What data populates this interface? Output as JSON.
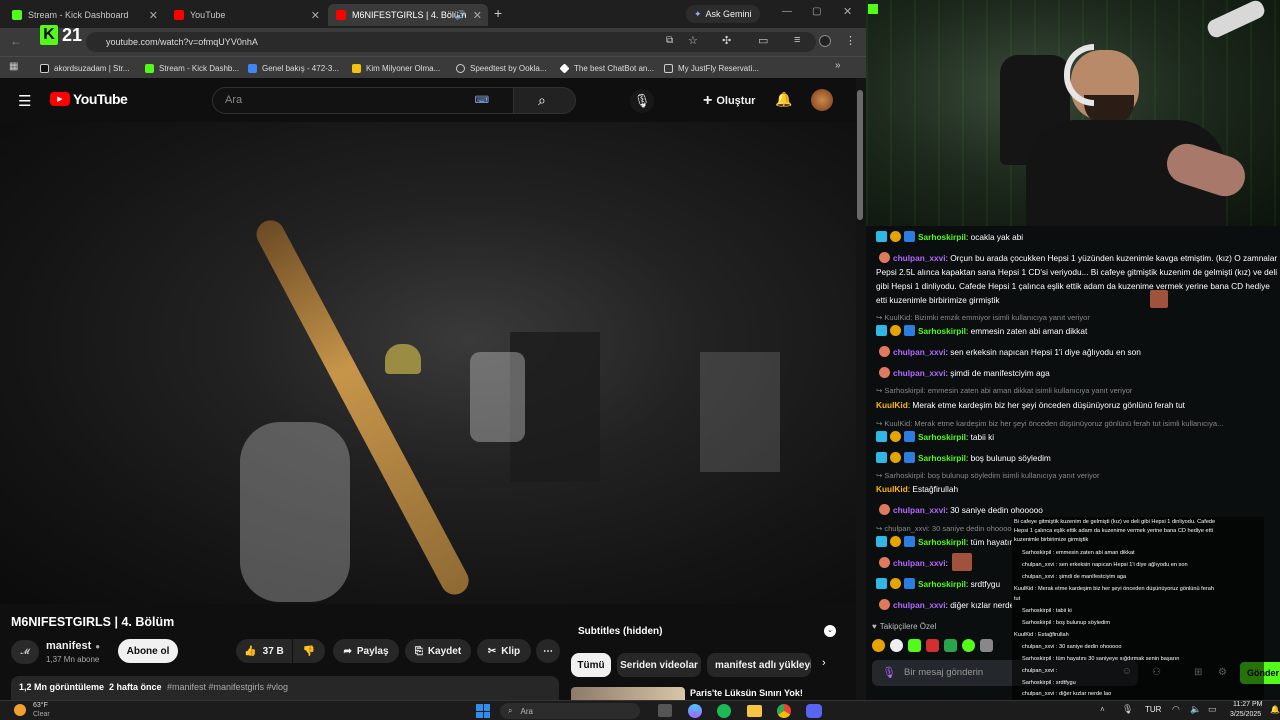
{
  "browser": {
    "tabs": [
      {
        "label": "Stream - Kick Dashboard",
        "favicon_color": "#53fc18"
      },
      {
        "label": "YouTube",
        "favicon_color": "#ff0000"
      },
      {
        "label": "M6NIFESTGIRLS | 4. Bölüm",
        "favicon_color": "#ff0000"
      }
    ],
    "new_tab": "+",
    "ask_gemini": "Ask Gemini",
    "url": "youtube.com/watch?v=ofmqUYV0nhA",
    "bookmarks": [
      "akordsuzadam | Str...",
      "Stream - Kick Dashb...",
      "Genel bakış - 472-3...",
      "Kim Milyoner Olma...",
      "Speedtest by Ookla...",
      "The best ChatBot an...",
      "My JustFly Reservati..."
    ],
    "overlay_badge": "21"
  },
  "youtube": {
    "logo": "YouTube",
    "search_placeholder": "Ara",
    "create_label": "Oluştur",
    "video_title": "M6NIFESTGIRLS | 4. Bölüm",
    "channel_name": "manifest",
    "subscribers": "1,37 Mn abone",
    "subscribe_label": "Abone ol",
    "likes": "37 B",
    "share_label": "Paylaş",
    "save_label": "Kaydet",
    "clip_label": "Klip",
    "views": "1,2 Mn görüntüleme",
    "age": "2 hafta önce",
    "tags": "#manifest #manifestgirls #vlog",
    "subtitles": "Subtitles (hidden)",
    "chips": [
      "Tümü",
      "Seriden videolar",
      "manifest adlı yükleyic"
    ],
    "next_video": "Paris'te Lüksün Sınırı Yok!"
  },
  "chat": {
    "messages": [
      {
        "user": "Sarhoskirpil",
        "text": ": ocakla yak abi",
        "color": "#53fc18"
      },
      {
        "user": "chulpan_xxvi",
        "text": ": Orçun bu arada çocukken Hepsi 1 yüzünden kuzenimle kavga etmiştim. (kız) O zamnalar Pepsi 2.5L alınca kapaktan sana Hepsi 1 CD'si veriyodu... Bi cafeye gitmiştik kuzenim de gelmişti (kız) ve deli gibi Hepsi 1 dinliyodu. Cafede Hepsi 1 çalınca eşlik ettik adam da kuzenime vermek yerine bana CD hediye etti kuzenimle birbirimize girmiştik",
        "color": "#b267ff"
      },
      {
        "reply": "KuulKid: Bizimki emzik emmiyor isimli kullanıcıya yanıt veriyor"
      },
      {
        "user": "Sarhoskirpil",
        "text": ": emmesin zaten abi aman dikkat",
        "color": "#53fc18"
      },
      {
        "user": "chulpan_xxvi",
        "text": ": sen erkeksin napıcan Hepsi 1'i diye ağlıyodu en son",
        "color": "#b267ff"
      },
      {
        "user": "chulpan_xxvi",
        "text": ": şimdi de manifestciyim aga",
        "color": "#b267ff"
      },
      {
        "reply": "Sarhoskirpil: emmesin zaten abi aman dikkat isimli kullanıcıya yanıt veriyor"
      },
      {
        "user": "KuulKid",
        "text": ": Merak etme kardeşim biz her şeyi önceden düşünüyoruz gönlünü ferah tut",
        "color": "#ffb500"
      },
      {
        "reply": "KuulKid: Merak etme kardeşim biz her şeyi önceden düşünüyoruz gönlünü ferah tut isimli kullanıcıya..."
      },
      {
        "user": "Sarhoskirpil",
        "text": ": tabii ki",
        "color": "#53fc18"
      },
      {
        "user": "Sarhoskirpil",
        "text": ": boş bulunup söyledim",
        "color": "#53fc18"
      },
      {
        "reply": "Sarhoskirpil: boş bulunup söyledim isimli kullanıcıya yanıt veriyor"
      },
      {
        "user": "KuulKid",
        "text": ": Estağfirullah",
        "color": "#ffb500"
      },
      {
        "user": "chulpan_xxvi",
        "text": ": 30 saniye dedin ohooooo",
        "color": "#b267ff"
      },
      {
        "reply": "chulpan_xxvi: 30 saniye dedin ohooooo"
      },
      {
        "user": "Sarhoskirpil",
        "text": ": tüm hayatını 30 saniyeye sığdırmak senin başarın",
        "color": "#53fc18"
      },
      {
        "user": "chulpan_xxvi",
        "text": ":",
        "color": "#b267ff"
      },
      {
        "user": "Sarhoskirpil",
        "text": ": srdtfygu",
        "color": "#53fc18"
      },
      {
        "user": "chulpan_xxvi",
        "text": ": diğer kızlar nerde lao",
        "color": "#b267ff"
      }
    ],
    "follower_label": "Takipçilere Özel",
    "input_placeholder": "Bir mesaj gönderin",
    "send_label": "Gönder"
  },
  "overlay": {
    "lines": [
      "Bi cafeye gitmiştik kuzenim de gelmişti (kız) ve deli gibi Hepsi 1 dinliyodu. Cafede",
      "Hepsi 1 çalınca eşlik ettik adam da kuzenime vermek yerine bana CD hediye etti",
      "kuzenimle birbirimize girmiştik",
      "Sarhoskirpil : emmesin zaten abi aman dikkat",
      "chulpan_xxvi : sen erkeksin napıcan Hepsi 1'i diye ağlıyodu en son",
      "chulpan_xxvi : şimdi de manifestciyim aga",
      "KuulKid : Merak etme kardeşim biz her şeyi önceden düşünüyoruz gönlünü ferah",
      "tut",
      "Sarhoskirpil : tabii ki",
      "Sarhoskirpil : boş bulunup söyledim",
      "KuulKid : Estağfirullah",
      "chulpan_xxvi : 30 saniye dedin ohooooo",
      "Sarhoskirpil : tüm hayatını 30 saniyeye sığdırmak senin başarın",
      "chulpan_xxvi :",
      "Sarhoskirpil : srdtfygu",
      "chulpan_xxvi : diğer kızlar nerde lao"
    ]
  },
  "taskbar": {
    "weather_temp": "63°F",
    "weather_desc": "Clear",
    "search": "Ara",
    "lang": "TUR",
    "time": "11:27 PM",
    "date": "3/25/2025"
  }
}
